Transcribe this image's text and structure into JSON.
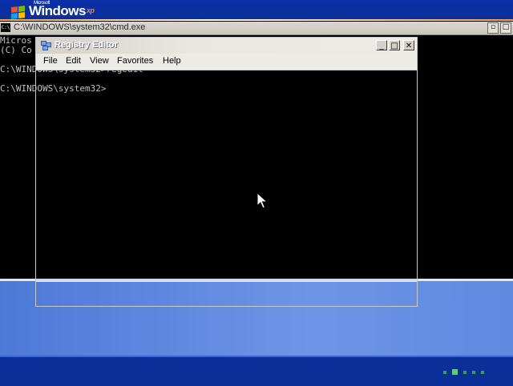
{
  "desktop": {
    "logo_small": "Microsoft",
    "logo_main": "Windows",
    "logo_suffix": "xp"
  },
  "cmd_window": {
    "title": "C:\\WINDOWS\\system32\\cmd.exe",
    "icon_label": "C:\\",
    "lines": [
      "Micros",
      "(C) Co",
      "",
      "C:\\WINDOWS\\system32>regedit",
      "",
      "C:\\WINDOWS\\system32>"
    ]
  },
  "regedit_window": {
    "title": "Registry Editor",
    "menu": [
      "File",
      "Edit",
      "View",
      "Favorites",
      "Help"
    ]
  },
  "colors": {
    "console_bg": "#000000",
    "console_text": "#c0c0c0",
    "xp_blue": "#0b2f98",
    "desktop_blue": "#5f8ae0"
  }
}
